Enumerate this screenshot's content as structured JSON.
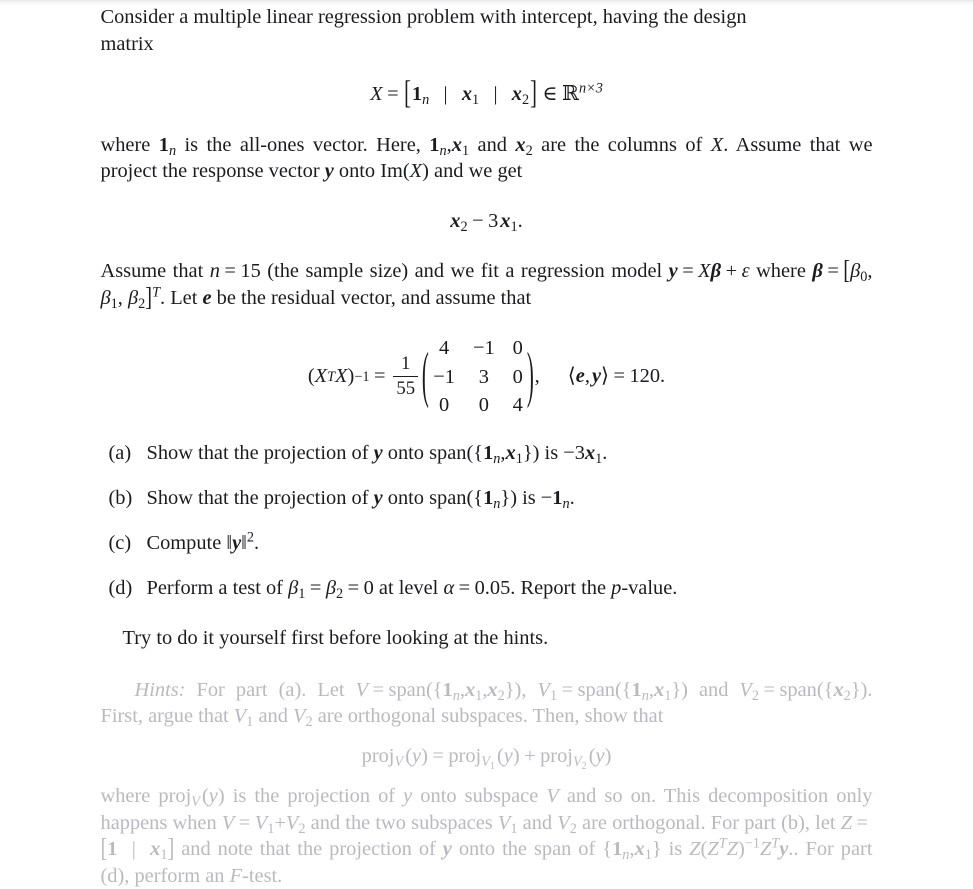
{
  "document": {
    "type": "math-exercise",
    "colors": {
      "body_text": "#1b1b22",
      "hint_text": "#b9b9c2",
      "background": "#ffffff"
    },
    "intro": {
      "line_1_a": "Consider a multiple linear regression problem with intercept, having the design",
      "line_1_b": "matrix"
    },
    "equation_design_matrix": {
      "lhs": "X",
      "equals": "=",
      "bracket_open": "[",
      "col_1_base": "1",
      "col_1_sub": "n",
      "separator": "|",
      "col_2_base": "x",
      "col_2_sub": "1",
      "col_3_base": "x",
      "col_3_sub": "2",
      "bracket_close": "]",
      "member": "∈",
      "set_symbol": "ℝ",
      "set_exponent": "n×3"
    },
    "paragraph_2": {
      "seg_1": "where ",
      "ones_base": "1",
      "ones_sub": "n",
      "seg_2": " is the all-ones vector. Here, ",
      "seg_3": " and ",
      "seg_4": " are the columns of ",
      "seg_5": ". Assume that we project the response vector ",
      "vec_y": "y",
      "seg_6": " onto Im(",
      "seg_7": ") and we get",
      "X": "X",
      "x_base": "x",
      "x1_sub": "1",
      "x2_sub": "2"
    },
    "equation_projection_result": {
      "x_base": "x",
      "sub_2": "2",
      "minus": "−",
      "coef": "3",
      "sub_1": "1",
      "period": "."
    },
    "paragraph_3": {
      "seg_1": "Assume that ",
      "n": "n",
      "eq": "=",
      "n_value": "15",
      "seg_2": " (the sample size) and we fit a regression model ",
      "y": "y",
      "X": "X",
      "beta": "β",
      "plus": "+",
      "epsilon": "ε",
      "seg_3": " where ",
      "beta_0": "0",
      "beta_1": "1",
      "beta_2": "2",
      "transpose": "T",
      "seg_4": ". Let ",
      "e": "e",
      "seg_5": " be the residual vector, and assume that"
    },
    "equation_inverse_gram": {
      "lhs_open": "(",
      "lhs_X": "X",
      "lhs_T": "T",
      "lhs_X2": "X",
      "lhs_close": ")",
      "lhs_exp": "−1",
      "equals": "=",
      "frac_num": "1",
      "frac_den": "55",
      "matrix_rows": [
        [
          "4",
          "−1",
          "0"
        ],
        [
          "−1",
          "3",
          "0"
        ],
        [
          "0",
          "0",
          "4"
        ]
      ],
      "comma": ",",
      "inner_open": "⟨",
      "inner_e": "e",
      "inner_comma": ",",
      "inner_y": "y",
      "inner_close": "⟩",
      "inner_equals": "=",
      "inner_value": "120",
      "period": "."
    },
    "items": [
      {
        "label": "(a)",
        "seg_1": "Show that the projection of ",
        "y": "y",
        "seg_2": " onto span({",
        "ones": "1",
        "ones_sub": "n",
        "comma": ",",
        "x": "x",
        "x_sub": "1",
        "seg_3": "}) is ",
        "minus": "−",
        "coef": "3",
        "res_x": "x",
        "res_sub": "1",
        "period": "."
      },
      {
        "label": "(b)",
        "seg_1": "Show that the projection of ",
        "y": "y",
        "seg_2": " onto span({",
        "ones": "1",
        "ones_sub": "n",
        "seg_3": "}) is ",
        "minus": "−",
        "res_ones": "1",
        "res_sub": "n",
        "period": "."
      },
      {
        "label": "(c)",
        "seg_1": "Compute ‖",
        "y": "y",
        "seg_2": "‖",
        "exp": "2",
        "period": "."
      },
      {
        "label": "(d)",
        "seg_1": "Perform a test of ",
        "beta": "β",
        "sub_1": "1",
        "eq_1": "=",
        "sub_2": "2",
        "eq_2": "=",
        "zero": "0",
        "seg_2": " at level ",
        "alpha": "α",
        "eq_3": "=",
        "alpha_value": "0.05",
        "seg_3": ". Report the ",
        "p": "p",
        "seg_4": "-value."
      }
    ],
    "try_yourself": "Try to do it yourself first before looking at the hints.",
    "hints": {
      "label": "Hints:",
      "seg_1": " For part (a). Let ",
      "V": "V",
      "eq": "=",
      "span": "span",
      "seg_open": "({",
      "ones": "1",
      "ones_sub": "n",
      "comma": ",",
      "x": "x",
      "x1": "1",
      "x2": "2",
      "seg_close": "})",
      "V1": "V",
      "V1_sub": "1",
      "seg_2": " and ",
      "V2": "V",
      "V2_sub": "2",
      "seg_3": ". First, argue that ",
      "seg_4": " and ",
      "seg_5": " are orthogonal subspaces. Then, show that",
      "equation": {
        "proj": "proj",
        "V": "V",
        "open": "(",
        "y": "y",
        "close": ")",
        "equals": "=",
        "V1_sub": "1",
        "plus": "+",
        "V2_sub": "2"
      },
      "closing": {
        "seg_1": "where proj",
        "V": "V",
        "seg_2": "(",
        "y": "y",
        "seg_3": ") is the projection of ",
        "seg_4": " onto subspace ",
        "seg_5": " and so on. This decomposition only happens when ",
        "eq": "=",
        "plus": "+",
        "seg_6": " and the two subspaces ",
        "seg_7": " and ",
        "seg_8": " are orthogonal. For part (b), let ",
        "Z": "Z",
        "bracket_open": "[",
        "one": "1",
        "bar": "|",
        "x": "x",
        "x_sub": "1",
        "bracket_close": "]",
        "seg_9": " and note that the projection of ",
        "seg_10": " onto the span of {",
        "ones": "1",
        "ones_sub": "n",
        "seg_11": "} is ",
        "ZTZ_open": "(",
        "T": "T",
        "ZTZ_close": ")",
        "exp_neg1": "−1",
        "seg_12": ". For part (d), perform an ",
        "F": "F",
        "seg_13": "-test."
      }
    }
  }
}
